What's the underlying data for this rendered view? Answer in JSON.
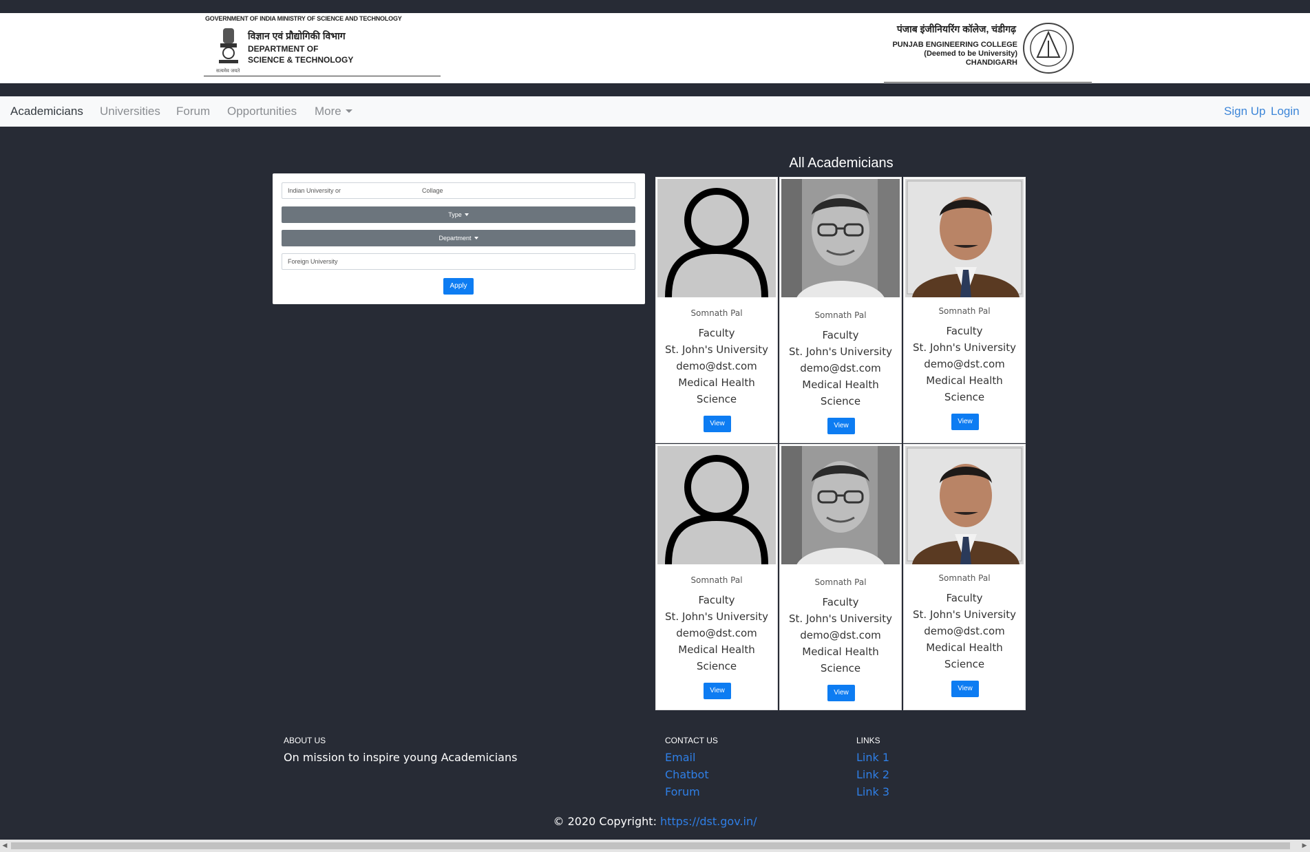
{
  "header": {
    "gov_line": "GOVERNMENT OF INDIA   MINISTRY OF SCIENCE AND TECHNOLOGY",
    "gov_hindi": "विज्ञान एवं प्रौद्योगिकी विभाग",
    "gov_dept_line1": "DEPARTMENT OF",
    "gov_dept_line2": "SCIENCE & TECHNOLOGY",
    "gov_small": "सत्यमेव जयते",
    "pec_hindi": "पंजाब इंजीनियरिंग कॉलेज, चंडीगढ़",
    "pec_line1": "PUNJAB ENGINEERING COLLEGE",
    "pec_line2": "(Deemed to be University)",
    "pec_line3": "CHANDIGARH"
  },
  "nav": {
    "items": [
      "Academicians",
      "Universities",
      "Forum",
      "Opportunities",
      "More"
    ],
    "signup": "Sign Up",
    "login": "Login"
  },
  "filter": {
    "indian_uni_placeholder": "Indian University or",
    "college_placeholder": "Collage",
    "type_label": "Type",
    "department_label": "Department",
    "foreign_uni_placeholder": "Foreign University",
    "apply_label": "Apply"
  },
  "grid": {
    "title": "All Academicians",
    "cards": [
      {
        "photo": "placeholder-avatar",
        "name": "Somnath Pal",
        "role": "Faculty",
        "university": "St. John's University",
        "email": "demo@dst.com",
        "dept1": "Medical Health",
        "dept2": "Science",
        "view": "View"
      },
      {
        "photo": "man-glasses-photo",
        "name": "Somnath Pal",
        "role": "Faculty",
        "university": "St. John's University",
        "email": "demo@dst.com",
        "dept1": "Medical Health",
        "dept2": "Science",
        "view": "View"
      },
      {
        "photo": "man-suit-photo",
        "name": "Somnath Pal",
        "role": "Faculty",
        "university": "St. John's University",
        "email": "demo@dst.com",
        "dept1": "Medical Health",
        "dept2": "Science",
        "view": "View"
      },
      {
        "photo": "placeholder-avatar",
        "name": "Somnath Pal",
        "role": "Faculty",
        "university": "St. John's University",
        "email": "demo@dst.com",
        "dept1": "Medical Health",
        "dept2": "Science",
        "view": "View"
      },
      {
        "photo": "man-glasses-photo",
        "name": "Somnath Pal",
        "role": "Faculty",
        "university": "St. John's University",
        "email": "demo@dst.com",
        "dept1": "Medical Health",
        "dept2": "Science",
        "view": "View"
      },
      {
        "photo": "man-suit-photo",
        "name": "Somnath Pal",
        "role": "Faculty",
        "university": "St. John's University",
        "email": "demo@dst.com",
        "dept1": "Medical Health",
        "dept2": "Science",
        "view": "View"
      }
    ]
  },
  "footer": {
    "about_head": "ABOUT US",
    "about_text": "On mission to inspire young Academicians",
    "contact_head": "CONTACT US",
    "contact_links": [
      "Email",
      "Chatbot",
      "Forum"
    ],
    "links_head": "LINKS",
    "links": [
      "Link 1",
      "Link 2",
      "Link 3"
    ],
    "copyright": "© 2020 Copyright: ",
    "copyright_link": "https://dst.gov.in/"
  },
  "colors": {
    "background": "#272b35",
    "primary": "#0d7cf2",
    "secondary": "#6c757d",
    "link": "#2f7fe6"
  }
}
